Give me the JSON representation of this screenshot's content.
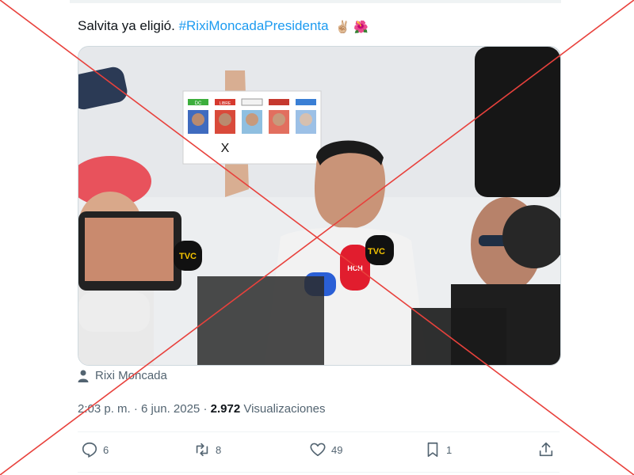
{
  "tweet": {
    "text_plain": "Salvita ya eligió. ",
    "hashtag": "#RixiMoncadaPresidenta",
    "emojis": "✌🏼 🌺"
  },
  "photo": {
    "ballot": {
      "party_labels": [
        "DC",
        "LIBRE",
        "",
        "",
        ""
      ],
      "mark": "X"
    },
    "mic_brands": [
      "TVC",
      "TVC",
      "HCH"
    ]
  },
  "tagged_user": "Rixi Moncada",
  "meta": {
    "time": "2:03 p. m.",
    "separator": "·",
    "date": "6 jun. 2025",
    "views_count": "2.972",
    "views_label": "Visualizaciones"
  },
  "actions": {
    "replies": "6",
    "reposts": "8",
    "likes": "49",
    "bookmarks": "1"
  },
  "colors": {
    "hashtag": "#1d9bf0",
    "secondary_text": "#536471",
    "overlay_x": "#e8413c"
  }
}
